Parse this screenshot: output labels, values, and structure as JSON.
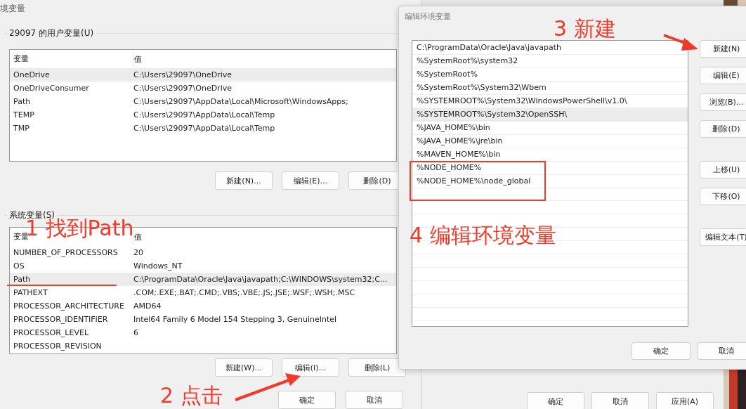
{
  "main_window": {
    "title": "境变量",
    "user_vars": {
      "label": "29097 的用户变量(U)",
      "columns": [
        "变量",
        "值"
      ],
      "rows": [
        {
          "name": "OneDrive",
          "value": "C:\\Users\\29097\\OneDrive",
          "selected": true
        },
        {
          "name": "OneDriveConsumer",
          "value": "C:\\Users\\29097\\OneDrive",
          "selected": false
        },
        {
          "name": "Path",
          "value": "C:\\Users\\29097\\AppData\\Local\\Microsoft\\WindowsApps;",
          "selected": false
        },
        {
          "name": "TEMP",
          "value": "C:\\Users\\29097\\AppData\\Local\\Temp",
          "selected": false
        },
        {
          "name": "TMP",
          "value": "C:\\Users\\29097\\AppData\\Local\\Temp",
          "selected": false
        }
      ],
      "buttons": [
        "新建(N)...",
        "编辑(E)...",
        "删除(D)"
      ]
    },
    "system_vars": {
      "label": "系统变量(S)",
      "columns": [
        "变量",
        "值"
      ],
      "rows": [
        {
          "name": "NUMBER_OF_PROCESSORS",
          "value": "20",
          "selected": false
        },
        {
          "name": "OS",
          "value": "Windows_NT",
          "selected": false
        },
        {
          "name": "Path",
          "value": "C:\\ProgramData\\Oracle\\Java\\javapath;C:\\WINDOWS\\system32;C...",
          "selected": true
        },
        {
          "name": "PATHEXT",
          "value": ".COM;.EXE;.BAT;.CMD;.VBS;.VBE;.JS;.JSE;.WSF;.WSH;.MSC",
          "selected": false
        },
        {
          "name": "PROCESSOR_ARCHITECTURE",
          "value": "AMD64",
          "selected": false
        },
        {
          "name": "PROCESSOR_IDENTIFIER",
          "value": "Intel64 Family 6 Model 154 Stepping 3, GenuineIntel",
          "selected": false
        },
        {
          "name": "PROCESSOR_LEVEL",
          "value": "6",
          "selected": false
        },
        {
          "name": "PROCESSOR_REVISION",
          "selected": false
        }
      ],
      "buttons": [
        "新建(W)...",
        "编辑(I)...",
        "删除(L)"
      ]
    },
    "buttons": [
      "确定",
      "取消"
    ]
  },
  "back_window": {
    "buttons": [
      "确定",
      "取消",
      "应用(A)"
    ]
  },
  "edit_dialog": {
    "title": "编辑环境变量",
    "entries": [
      {
        "text": "C:\\ProgramData\\Oracle\\Java\\javapath",
        "selected": false
      },
      {
        "text": "%SystemRoot%\\system32",
        "selected": false
      },
      {
        "text": "%SystemRoot%",
        "selected": false
      },
      {
        "text": "%SystemRoot%\\System32\\Wbem",
        "selected": false
      },
      {
        "text": "%SYSTEMROOT%\\System32\\WindowsPowerShell\\v1.0\\",
        "selected": false
      },
      {
        "text": "%SYSTEMROOT%\\System32\\OpenSSH\\",
        "selected": true
      },
      {
        "text": "%JAVA_HOME%\\bin",
        "selected": false
      },
      {
        "text": "%JAVA_HOME%\\jre\\bin",
        "selected": false
      },
      {
        "text": "%MAVEN_HOME%\\bin",
        "selected": false
      },
      {
        "text": "%NODE_HOME%",
        "selected": false
      },
      {
        "text": "%NODE_HOME%\\node_global",
        "selected": false
      }
    ],
    "side_buttons": [
      {
        "label": "新建(N)",
        "kind": "button"
      },
      {
        "label": "编辑(E)",
        "kind": "button"
      },
      {
        "label": "浏览(B)...",
        "kind": "button"
      },
      {
        "label": "删除(D)",
        "kind": "button"
      },
      {
        "label": "上移(U)",
        "kind": "spaced"
      },
      {
        "label": "下移(O)",
        "kind": "button"
      },
      {
        "label": "编辑文本(T)",
        "kind": "spaced"
      }
    ],
    "footer_buttons": [
      "确定",
      "取消"
    ]
  },
  "annotations": [
    "1 找到Path",
    "2 点击",
    "3 新建",
    "4 编辑环境变量"
  ]
}
